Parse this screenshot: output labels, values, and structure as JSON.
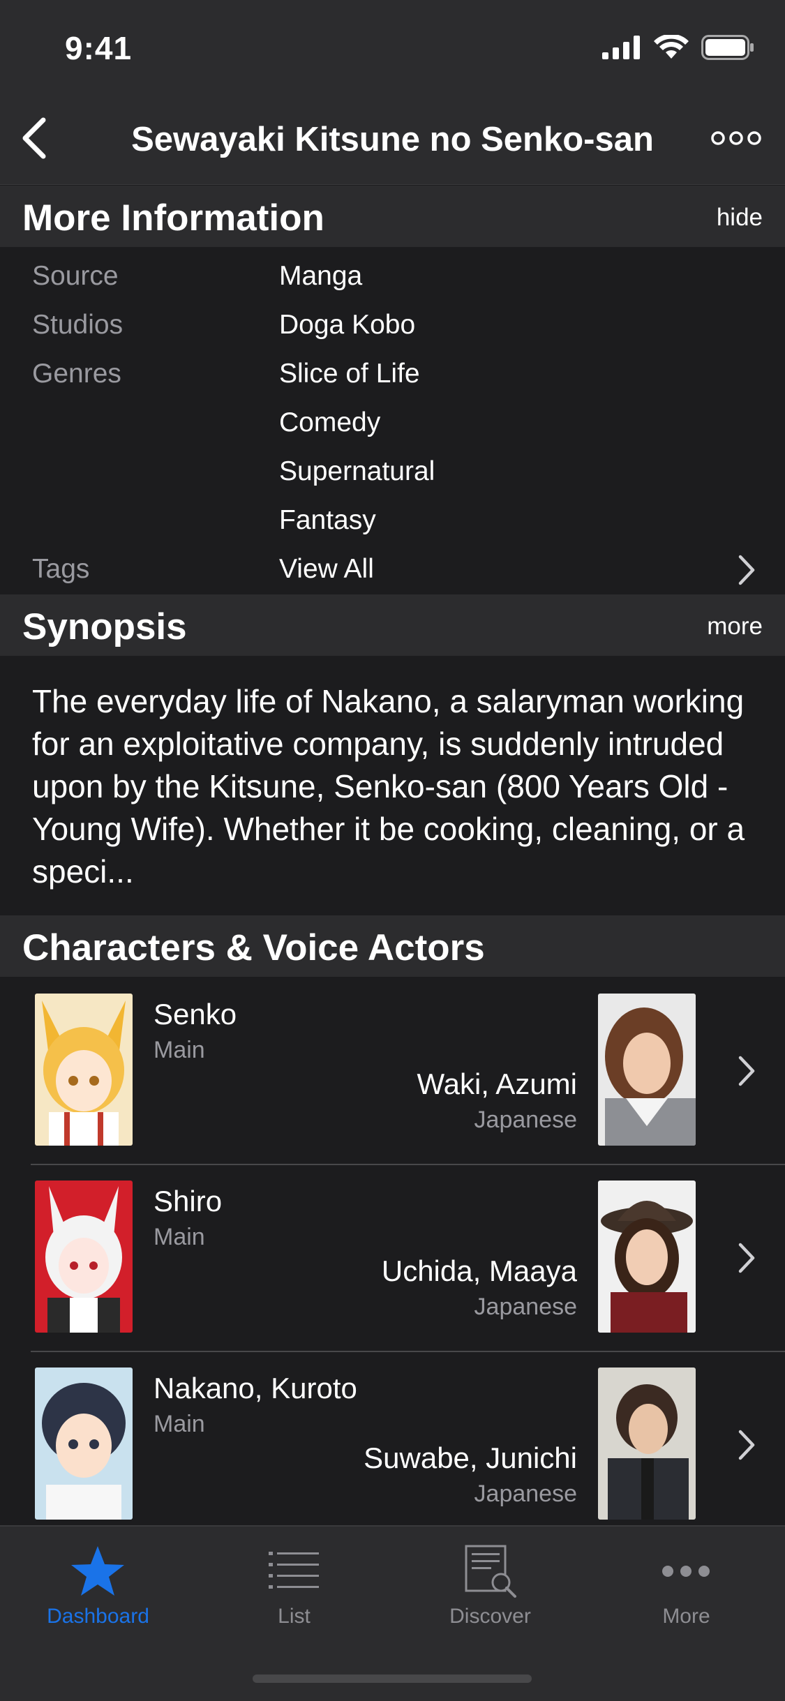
{
  "status_bar": {
    "time": "9:41"
  },
  "nav": {
    "title": "Sewayaki Kitsune no Senko-san"
  },
  "more_info": {
    "title": "More Information",
    "action": "hide",
    "rows": [
      {
        "label": "Source",
        "value": "Manga"
      },
      {
        "label": "Studios",
        "value": "Doga Kobo"
      },
      {
        "label": "Genres",
        "value": "Slice of Life"
      },
      {
        "label": "",
        "value": "Comedy"
      },
      {
        "label": "",
        "value": "Supernatural"
      },
      {
        "label": "",
        "value": "Fantasy"
      },
      {
        "label": "Tags",
        "value": "View All"
      }
    ]
  },
  "synopsis": {
    "title": "Synopsis",
    "action": "more",
    "text": "The everyday life of Nakano, a salaryman working for an exploitative company, is suddenly intruded upon by the Kitsune, Senko-san (800 Years Old - Young Wife). Whether it be cooking, cleaning, or a speci..."
  },
  "characters": {
    "title": "Characters & Voice Actors",
    "items": [
      {
        "name": "Senko",
        "role": "Main",
        "va_name": "Waki, Azumi",
        "va_language": "Japanese"
      },
      {
        "name": "Shiro",
        "role": "Main",
        "va_name": "Uchida, Maaya",
        "va_language": "Japanese"
      },
      {
        "name": "Nakano, Kuroto",
        "role": "Main",
        "va_name": "Suwabe, Junichi",
        "va_language": "Japanese"
      }
    ]
  },
  "tab_bar": {
    "tabs": [
      {
        "label": "Dashboard",
        "icon": "star-icon",
        "active": true
      },
      {
        "label": "List",
        "icon": "list-icon",
        "active": false
      },
      {
        "label": "Discover",
        "icon": "discover-icon",
        "active": false
      },
      {
        "label": "More",
        "icon": "more-dots-icon",
        "active": false
      }
    ]
  },
  "colors": {
    "accent": "#1a73e8",
    "background": "#1c1c1e",
    "header": "#2c2c2e",
    "secondary_text": "#9a9aa0"
  }
}
